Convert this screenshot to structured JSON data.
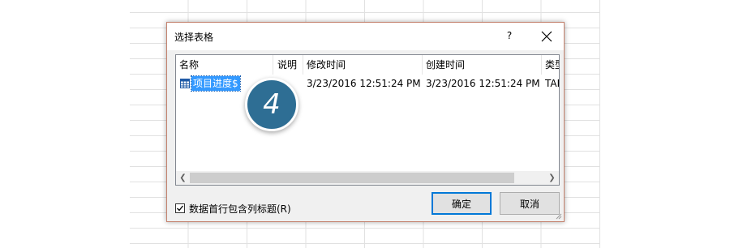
{
  "dialog": {
    "title": "选择表格",
    "help_label": "?",
    "columns": [
      {
        "label": "名称"
      },
      {
        "label": "说明"
      },
      {
        "label": "修改时间"
      },
      {
        "label": "创建时间"
      },
      {
        "label": "类型"
      }
    ],
    "rows": [
      {
        "name": "项目进度$",
        "description": "",
        "modified": "3/23/2016 12:51:24 PM",
        "created": "3/23/2016 12:51:24 PM",
        "type": "TAB"
      }
    ],
    "checkbox": {
      "label": "数据首行包含列标题(R)",
      "checked": true
    },
    "ok_label": "确定",
    "cancel_label": "取消"
  },
  "callout": {
    "number": "4"
  },
  "colors": {
    "accent": "#0078d7",
    "selection": "#3399ff",
    "callout": "#2e6e94",
    "dialog_border": "#c4826e"
  }
}
